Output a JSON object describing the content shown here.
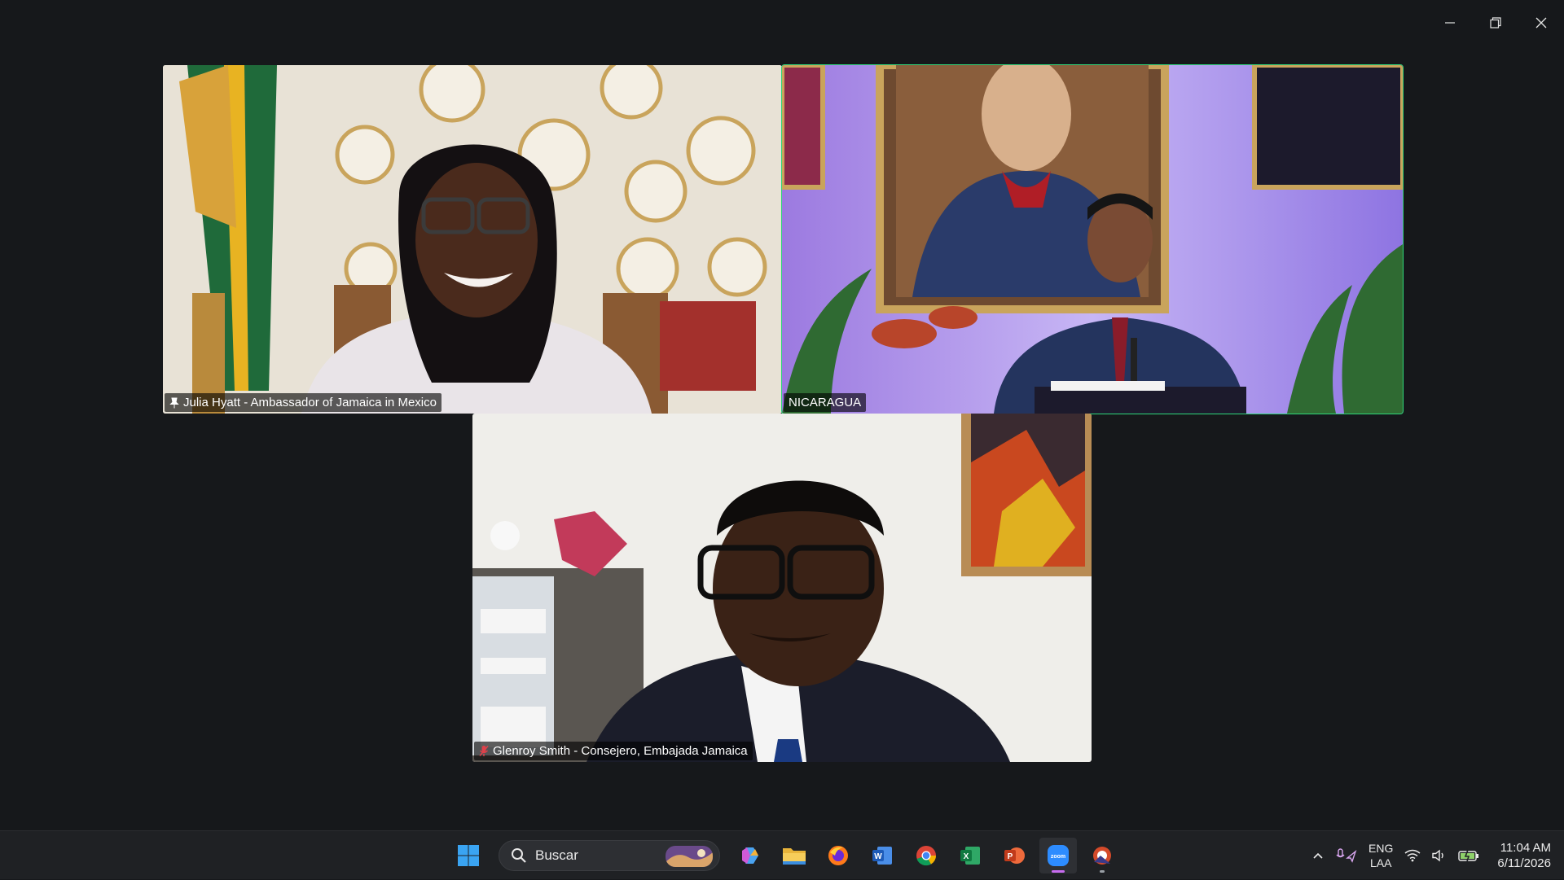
{
  "window": {
    "controls": {
      "minimize": "minimize",
      "restore": "restore",
      "close": "close"
    }
  },
  "participants": [
    {
      "name_label": "Julia Hyatt - Ambassador of Jamaica in Mexico",
      "icon": "pin-icon",
      "speaking": false
    },
    {
      "name_label": "NICARAGUA",
      "icon": "",
      "speaking": true
    },
    {
      "name_label": "Glenroy Smith - Consejero, Embajada Jamaica",
      "icon": "muted-mic-icon",
      "speaking": false
    }
  ],
  "taskbar": {
    "search_placeholder": "Buscar",
    "apps": [
      "start",
      "search",
      "copilot",
      "file-explorer",
      "firefox",
      "word",
      "chrome",
      "excel",
      "powerpoint",
      "zoom",
      "other-app"
    ],
    "active_app": "zoom",
    "tray": {
      "language_top": "ENG",
      "language_bottom": "LAA",
      "time": "11:04 AM",
      "date": "6/11/2026"
    }
  },
  "colors": {
    "speaking_border": "#2ed67a",
    "background": "#16181b",
    "taskbar": "#1f2124"
  }
}
